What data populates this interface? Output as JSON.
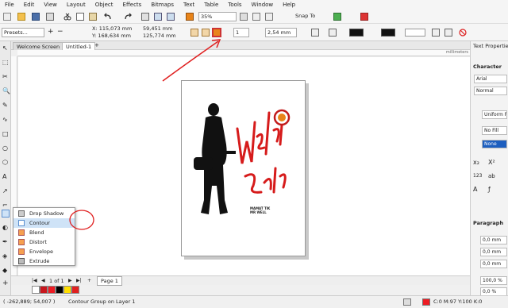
{
  "menu": [
    "File",
    "Edit",
    "View",
    "Layout",
    "Object",
    "Effects",
    "Bitmaps",
    "Text",
    "Table",
    "Tools",
    "Window",
    "Help"
  ],
  "toolbar": {
    "zoom": "35%",
    "snap_to": "Snap To"
  },
  "propbar": {
    "presets": "Presets...",
    "x": "X: 115,073 mm",
    "y": "Y: 168,634 mm",
    "w": "59,451 mm",
    "h": "125,774 mm",
    "steps": "1",
    "offset": "2,54 mm"
  },
  "tabs": {
    "welcome": "Welcome Screen",
    "doc": "Untitled-1"
  },
  "ruler_unit": "millimeters",
  "flyout": {
    "items": [
      "Drop Shadow",
      "Contour",
      "Blend",
      "Distort",
      "Envelope",
      "Extrude"
    ]
  },
  "artwork": {
    "caption_line1": "MAMAT TIK",
    "caption_line2": "MR WELL"
  },
  "rightpanel": {
    "title": "Text Properties",
    "character": "Character",
    "font": "Arial",
    "style": "Normal",
    "fill_type": "Uniform F",
    "bg_fill": "No Fill",
    "outline": "None",
    "paragraph": "Paragraph",
    "indent1": "0,0 mm",
    "indent2": "0,0 mm",
    "indent3": "0,0 mm",
    "line_spacing": "100,0 %",
    "before": "0,0 %"
  },
  "pagenav": {
    "counter": "1 of 1",
    "page_tab": "Page 1"
  },
  "status": {
    "coords": "( -262,889; 54,007 )",
    "object": "Contour Group on Layer 1",
    "fill": "C:0 M:97 Y:100 K:0"
  },
  "colors": {
    "accent_red": "#e02020",
    "brand_orange": "#e8841a",
    "selection_blue": "#cfe3f7"
  }
}
